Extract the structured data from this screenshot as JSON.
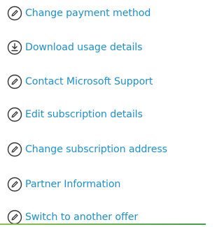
{
  "colors": {
    "link": "#1e90c9",
    "icon": "#333333",
    "bottom_bar": "#43a047"
  },
  "menu": {
    "items": [
      {
        "label": "Change payment method",
        "icon": "pencil-circle-icon"
      },
      {
        "label": "Download usage details",
        "icon": "download-circle-icon"
      },
      {
        "label": "Contact Microsoft Support",
        "icon": "pencil-circle-icon"
      },
      {
        "label": "Edit subscription details",
        "icon": "pencil-circle-icon"
      },
      {
        "label": "Change subscription address",
        "icon": "pencil-circle-icon"
      },
      {
        "label": "Partner Information",
        "icon": "pencil-circle-icon"
      },
      {
        "label": "Switch to another offer",
        "icon": "pencil-circle-icon"
      }
    ]
  }
}
